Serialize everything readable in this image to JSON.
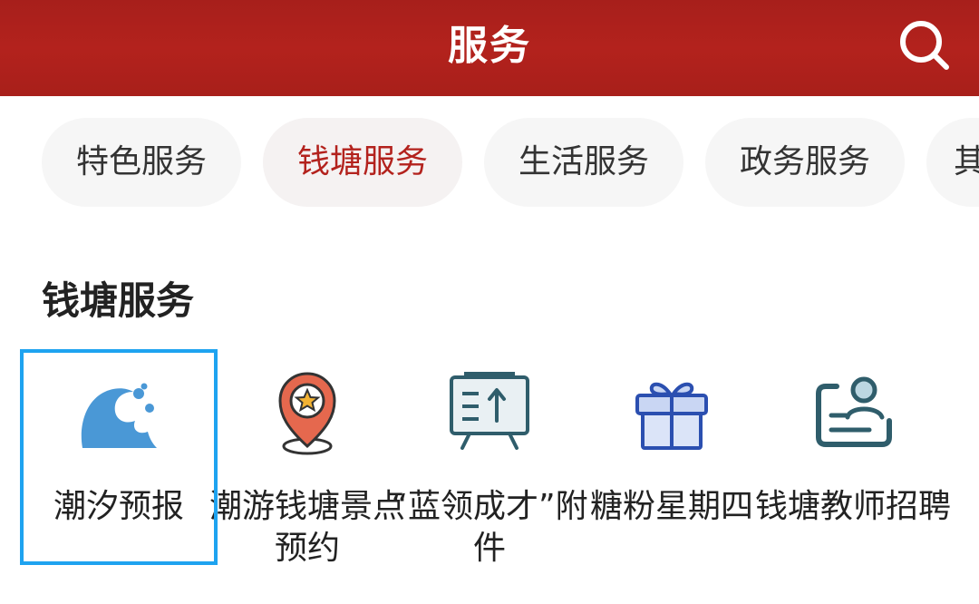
{
  "header": {
    "title": "服务"
  },
  "tabs": [
    {
      "label": "特色服务"
    },
    {
      "label": "钱塘服务"
    },
    {
      "label": "生活服务"
    },
    {
      "label": "政务服务"
    },
    {
      "label": "其"
    }
  ],
  "section": {
    "title": "钱塘服务"
  },
  "services": [
    {
      "label": "潮汐预报",
      "icon": "wave-icon"
    },
    {
      "label": "潮游钱塘景点预约",
      "icon": "map-pin-star-icon"
    },
    {
      "label": "“蓝领成才”附件",
      "icon": "board-arrow-icon"
    },
    {
      "label": "糖粉星期四",
      "icon": "gift-icon"
    },
    {
      "label": "钱塘教师招聘",
      "icon": "teacher-recruit-icon"
    }
  ],
  "colors": {
    "header_bg": "#b3221d",
    "active_tab_text": "#b3221d",
    "selection_border": "#1ea3f0"
  }
}
